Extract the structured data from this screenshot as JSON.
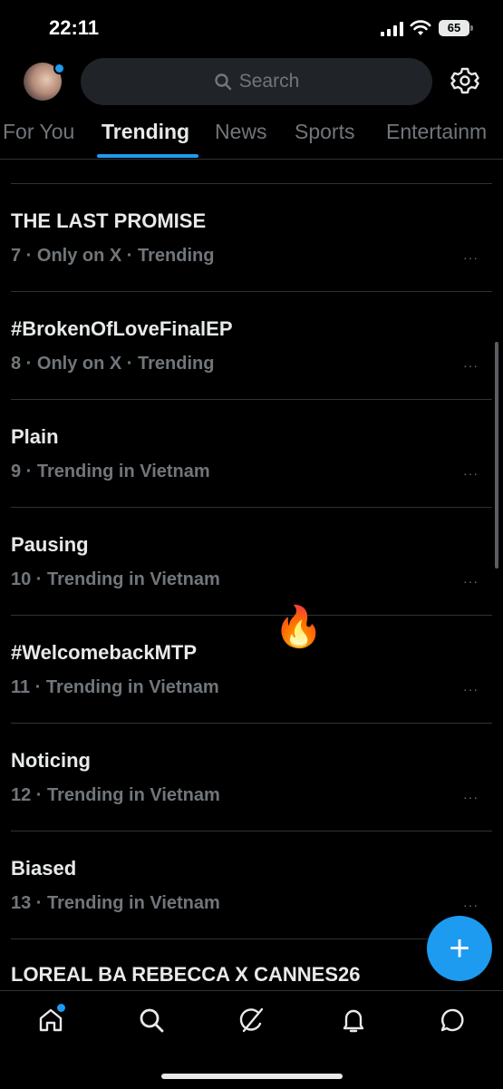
{
  "status": {
    "time": "22:11",
    "battery": "65"
  },
  "search": {
    "placeholder": "Search"
  },
  "tabs": [
    {
      "label": "For You"
    },
    {
      "label": "Trending"
    },
    {
      "label": "News"
    },
    {
      "label": "Sports"
    },
    {
      "label": "Entertainm"
    }
  ],
  "trends": [
    {
      "title": "THE LAST PROMISE",
      "meta": "7 · Only on X · Trending"
    },
    {
      "title": "#BrokenOfLoveFinalEP",
      "meta": "8 · Only on X · Trending"
    },
    {
      "title": "Plain",
      "meta": "9 · Trending in Vietnam"
    },
    {
      "title": "Pausing",
      "meta": "10 · Trending in Vietnam"
    },
    {
      "title": "#WelcomebackMTP",
      "meta": "11 · Trending in Vietnam"
    },
    {
      "title": "Noticing",
      "meta": "12 · Trending in Vietnam"
    },
    {
      "title": "Biased",
      "meta": "13 · Trending in Vietnam"
    }
  ],
  "partial_trend": {
    "title": "LOREAL BA REBECCA X CANNES26"
  },
  "more_glyph": "···",
  "fire_emoji": "🔥",
  "fab_glyph": "+",
  "colors": {
    "accent": "#1d9bf0",
    "background": "#000000",
    "muted": "#71767b"
  },
  "icons": [
    "search-icon",
    "gear-icon",
    "home-icon",
    "explore-icon",
    "grok-icon",
    "notifications-icon",
    "messages-icon"
  ]
}
